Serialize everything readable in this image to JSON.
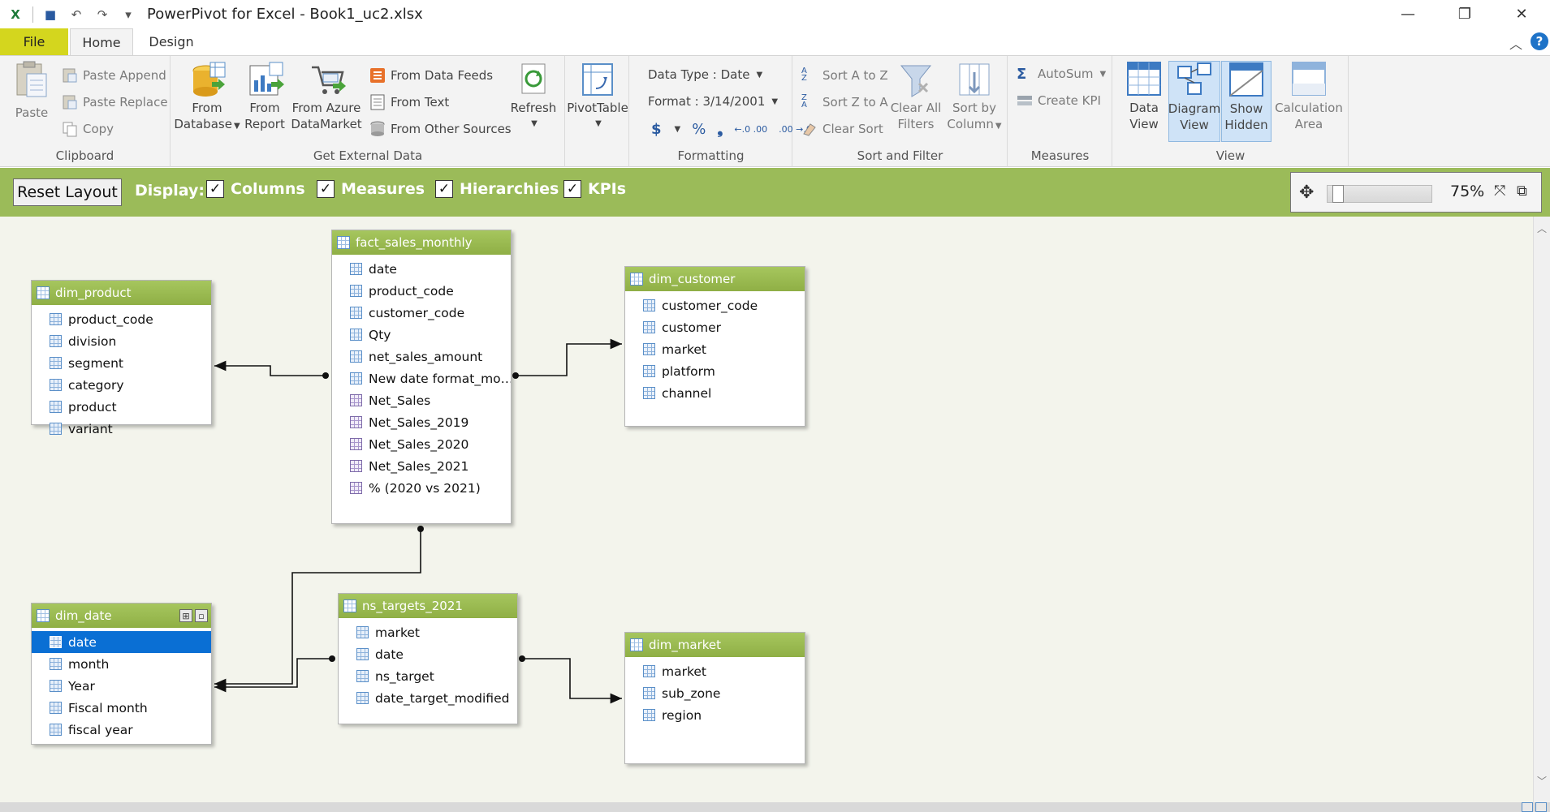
{
  "window": {
    "title": "PowerPivot for Excel - Book1_uc2.xlsx",
    "minimize": "—",
    "restore": "❐",
    "close": "✕"
  },
  "qat": {
    "excel": "X",
    "save": "💾",
    "undo": "↶",
    "redo": "↷",
    "more": "▾"
  },
  "tabs": {
    "file": "File",
    "home": "Home",
    "design": "Design",
    "collapse": "︿",
    "help": "?"
  },
  "ribbon": {
    "clipboard": {
      "label": "Clipboard",
      "paste": "Paste",
      "paste_append": "Paste Append",
      "paste_replace": "Paste Replace",
      "copy": "Copy"
    },
    "external": {
      "label": "Get External Data",
      "from_database": [
        "From",
        "Database"
      ],
      "from_report": [
        "From",
        "Report"
      ],
      "from_azure": [
        "From Azure",
        "DataMarket"
      ],
      "from_data_feeds": "From Data Feeds",
      "from_text": "From Text",
      "from_other": "From Other Sources",
      "refresh": "Refresh"
    },
    "pivot": {
      "pivottable": "PivotTable"
    },
    "formatting": {
      "label": "Formatting",
      "data_type": "Data Type : Date",
      "format": "Format : 3/14/2001",
      "currency": "$",
      "percent": "%",
      "comma": "❟",
      "inc_dec": "←.0 .00",
      "dec_dec": ".00 →.0"
    },
    "sort": {
      "label": "Sort and Filter",
      "sort_az": "Sort A to Z",
      "sort_za": "Sort Z to A",
      "clear_sort": "Clear Sort",
      "clear_filters": [
        "Clear All",
        "Filters"
      ],
      "sort_by_column": [
        "Sort by",
        "Column"
      ]
    },
    "measures": {
      "label": "Measures",
      "autosum": "AutoSum",
      "create_kpi": "Create KPI"
    },
    "view": {
      "label": "View",
      "data_view": [
        "Data",
        "View"
      ],
      "diagram_view": [
        "Diagram",
        "View"
      ],
      "show_hidden": [
        "Show",
        "Hidden"
      ],
      "calc_area": [
        "Calculation",
        "Area"
      ]
    }
  },
  "display_bar": {
    "reset_layout": "Reset Layout",
    "display": "Display:",
    "columns": "Columns",
    "measures": "Measures",
    "hierarchies": "Hierarchies",
    "kpis": "KPIs",
    "check": "✓",
    "zoom_value": "75%",
    "zoom_fraction": 0.05
  },
  "tables": {
    "fact_sales_monthly": {
      "name": "fact_sales_monthly",
      "rows": [
        "date",
        "product_code",
        "customer_code",
        "Qty",
        "net_sales_amount",
        "New date format_mo…",
        "Net_Sales",
        "Net_Sales_2019",
        "Net_Sales_2020",
        "Net_Sales_2021",
        "% (2020 vs 2021)"
      ]
    },
    "dim_product": {
      "name": "dim_product",
      "rows": [
        "product_code",
        "division",
        "segment",
        "category",
        "product",
        "variant"
      ]
    },
    "dim_customer": {
      "name": "dim_customer",
      "rows": [
        "customer_code",
        "customer",
        "market",
        "platform",
        "channel"
      ]
    },
    "dim_date": {
      "name": "dim_date",
      "rows": [
        "date",
        "month",
        "Year",
        "Fiscal month",
        "fiscal year"
      ]
    },
    "ns_targets_2021": {
      "name": "ns_targets_2021",
      "rows": [
        "market",
        "date",
        "ns_target",
        "date_target_modified"
      ]
    },
    "dim_market": {
      "name": "dim_market",
      "rows": [
        "market",
        "sub_zone",
        "region"
      ]
    }
  },
  "colors": {
    "accent_green": "#9bbb59",
    "file_tab": "#d4d61e",
    "selection": "#0a6fd4"
  }
}
